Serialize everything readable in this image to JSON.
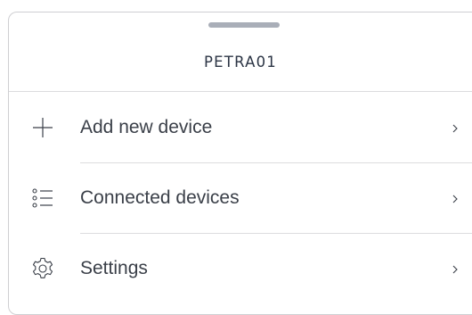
{
  "sheet": {
    "title": "PETRA01"
  },
  "menu": {
    "items": [
      {
        "label": "Add new device",
        "icon": "plus-icon"
      },
      {
        "label": "Connected devices",
        "icon": "list-icon"
      },
      {
        "label": "Settings",
        "icon": "gear-icon"
      }
    ]
  },
  "colors": {
    "text": "#3a3f48",
    "title": "#2c3545",
    "divider": "#dcdcde",
    "grabber": "#a9aeb8"
  }
}
